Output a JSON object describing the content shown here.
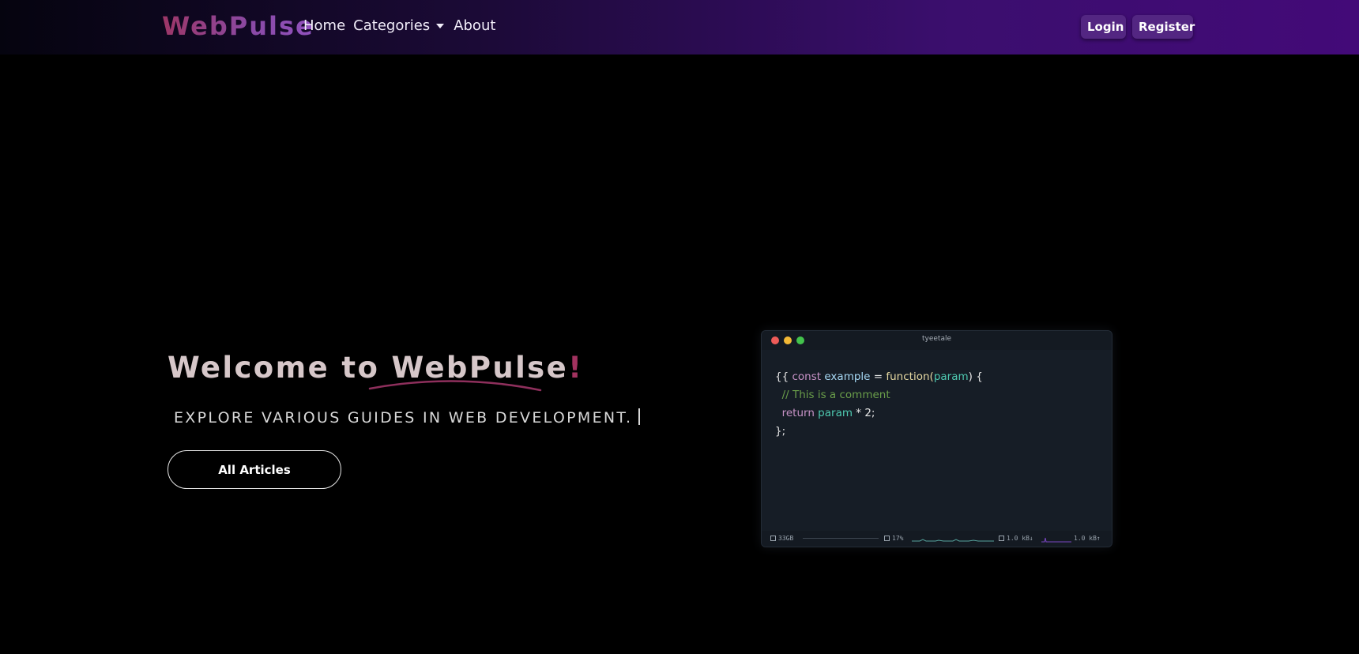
{
  "navbar": {
    "brand": "WebPulse",
    "links": [
      {
        "label": "Home"
      },
      {
        "label": "Categories"
      },
      {
        "label": "About"
      }
    ],
    "login_label": "Login",
    "register_label": "Register"
  },
  "hero": {
    "title_prefix": "Welcome to ",
    "title_brand": "WebPulse",
    "title_suffix": "!",
    "subtitle": "EXPLORE VARIOUS GUIDES IN WEB DEVELOPMENT.",
    "cta_label": "All Articles"
  },
  "terminal": {
    "title": "tyeetale",
    "code": {
      "l1_open": "{{ ",
      "l1_const": "const",
      "l1_name": "example",
      "l1_eq": " = ",
      "l1_fn": "function",
      "l1_paren_open": "(",
      "l1_param": "param",
      "l1_paren_close": ") {",
      "l2_comment": "// This is a comment",
      "l3_return": "return",
      "l3_param": "param",
      "l3_rest": " * 2;",
      "l4": "};"
    },
    "status": {
      "memory": "33GB",
      "cpu": "17%",
      "net_down": "1.0 kB↓",
      "net_up": "1.0 kB↑"
    }
  },
  "colors": {
    "navbar_gradient_start": "#05040f",
    "navbar_gradient_end": "#430a78",
    "button_bg": "#532682",
    "accent": "#a2325f",
    "terminal_bg": "#161d26"
  }
}
